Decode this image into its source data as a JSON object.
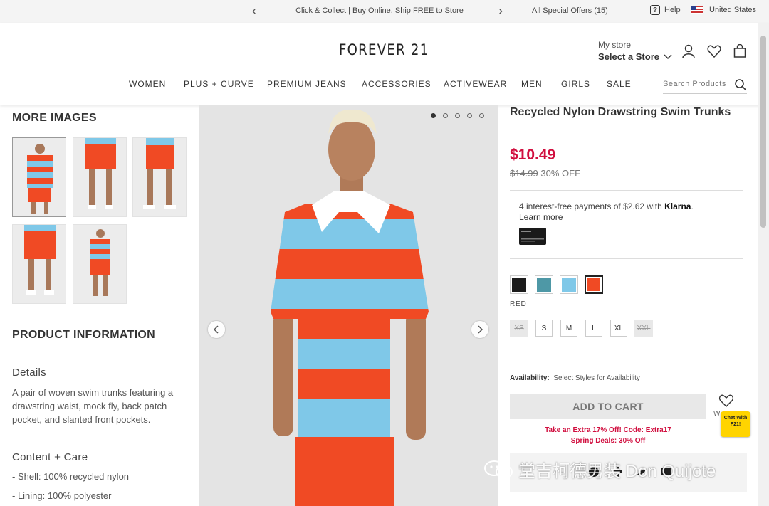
{
  "promo_bar": {
    "message": "Click & Collect | Buy Online, Ship FREE to Store",
    "offers": "All Special Offers (15)",
    "help": "Help",
    "country": "United States",
    "prev_arrow": "‹",
    "next_arrow": "›"
  },
  "header": {
    "logo": "FOREVER 21",
    "store_label": "My store",
    "store_value": "Select a Store",
    "nav": [
      "WOMEN",
      "PLUS + CURVE",
      "PREMIUM JEANS",
      "ACCESSORIES",
      "ACTIVEWEAR",
      "MEN",
      "GIRLS",
      "SALE"
    ],
    "search_placeholder": "Search Products"
  },
  "left": {
    "more_images_title": "MORE IMAGES",
    "product_info_title": "PRODUCT INFORMATION",
    "details_title": "Details",
    "details_text": "A pair of woven swim trunks featuring a drawstring waist, mock fly, back patch pocket, and slanted front pockets.",
    "content_title": "Content + Care",
    "content_items": [
      "- Shell: 100% recycled nylon",
      "- Lining: 100% polyester"
    ]
  },
  "product": {
    "title": "Recycled Nylon Drawstring Swim Trunks",
    "price": "$10.49",
    "original_price": "$14.99",
    "discount": "30% OFF",
    "klarna_text": "4 interest-free payments of $2.62 with",
    "klarna_brand": "Klarna",
    "klarna_period": ".",
    "learn_more": "Learn more",
    "colors": [
      "#1c1c1c",
      "#4e98a6",
      "#7fc8e8",
      "#f04a24"
    ],
    "selected_color_name": "RED",
    "sizes": [
      {
        "label": "XS",
        "available": false
      },
      {
        "label": "S",
        "available": true
      },
      {
        "label": "M",
        "available": true
      },
      {
        "label": "L",
        "available": true
      },
      {
        "label": "XL",
        "available": true
      },
      {
        "label": "XXL",
        "available": false
      }
    ],
    "availability_label": "Availability:",
    "availability_value": "Select Styles for Availability",
    "add_to_cart": "ADD TO CART",
    "wishlist_label": "Wi",
    "promo_line_1": "Take an Extra 17% Off! Code: Extra17",
    "promo_line_2": "Spring Deals: 30% Off",
    "chat_label": "Chat With F21!"
  },
  "watermark": {
    "text": "堂吉柯德男装 Don Quijote"
  },
  "colors": {
    "sale_red": "#d10f3f",
    "shirt_orange": "#f04a24",
    "shirt_blue": "#7fc8e8"
  }
}
